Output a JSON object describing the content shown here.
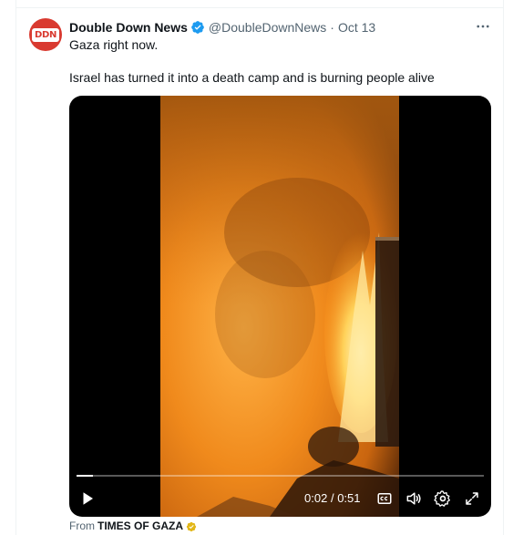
{
  "post": {
    "avatar_text": "DDN",
    "display_name": "Double Down News",
    "handle": "@DoubleDownNews",
    "separator": "·",
    "time": "Oct 13",
    "more_label": "···",
    "text_line1": "Gaza right now.",
    "text_line2": "Israel has turned it into a death camp and is burning people alive"
  },
  "video": {
    "elapsed": "0:02",
    "duration": "0:51",
    "time_separator": "/",
    "progress_fraction": 0.04
  },
  "attribution": {
    "prefix": "From",
    "source": "TIMES OF GAZA"
  },
  "colors": {
    "verified": "#1d9bf0",
    "avatar_bg": "#d93a30",
    "secondary_text": "#536471",
    "gold_badge": "#e2b719"
  },
  "icons": {
    "verified": "verified-badge-icon",
    "more": "more-icon",
    "play": "play-icon",
    "captions": "captions-icon",
    "volume": "volume-icon",
    "settings": "gear-icon",
    "fullscreen": "fullscreen-icon",
    "source_badge": "gold-badge-icon"
  }
}
